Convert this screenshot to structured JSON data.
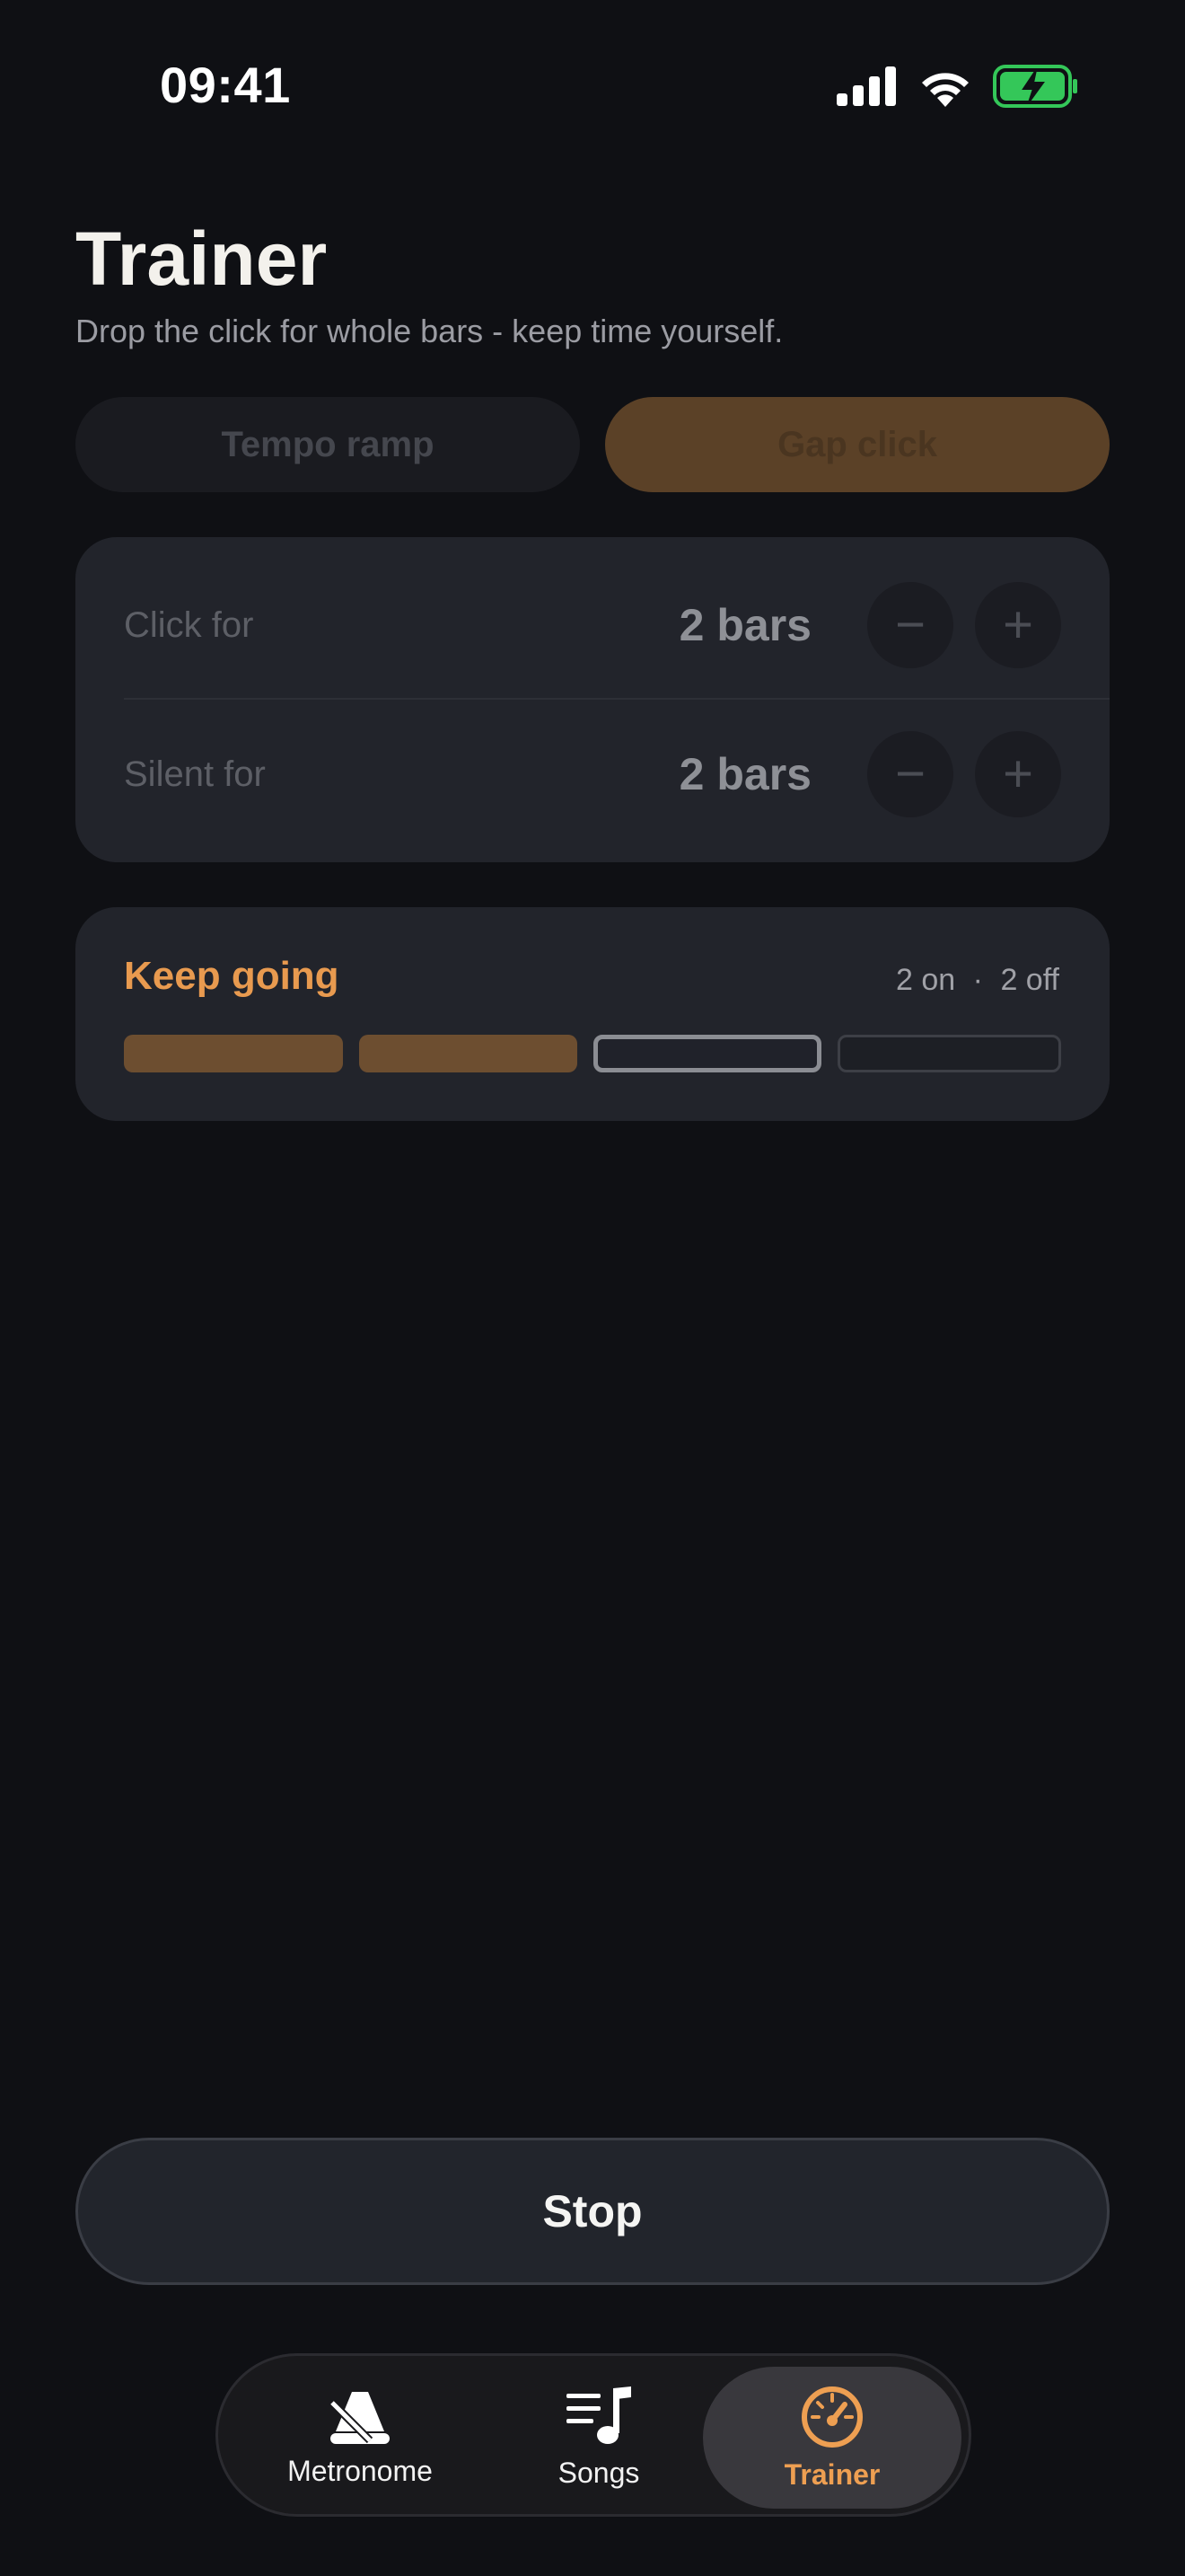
{
  "status_bar": {
    "time": "09:41"
  },
  "header": {
    "title": "Trainer",
    "subtitle": "Drop the click for whole bars - keep time yourself."
  },
  "mode_switch": {
    "options": [
      "Tempo ramp",
      "Gap click"
    ],
    "selected": "Gap click"
  },
  "settings": {
    "click_for": {
      "label": "Click for",
      "value": "2 bars",
      "decrement": "−",
      "increment": "+"
    },
    "silent_for": {
      "label": "Silent for",
      "value": "2 bars",
      "decrement": "−",
      "increment": "+"
    }
  },
  "progress": {
    "status": "Keep going",
    "on_text": "2 on",
    "separator": "·",
    "off_text": "2 off",
    "bars_total": 4,
    "bars_states": [
      "done",
      "done",
      "current",
      "pending"
    ]
  },
  "stop_button": {
    "label": "Stop"
  },
  "tabbar": {
    "tabs": [
      {
        "label": "Metronome",
        "icon": "metronome-icon"
      },
      {
        "label": "Songs",
        "icon": "music-list-icon"
      },
      {
        "label": "Trainer",
        "icon": "gauge-icon"
      }
    ],
    "active": "Trainer"
  },
  "colors": {
    "accent": "#ee9f52",
    "background": "#0f1014",
    "card": "#22242b",
    "battery": "#34c759"
  }
}
